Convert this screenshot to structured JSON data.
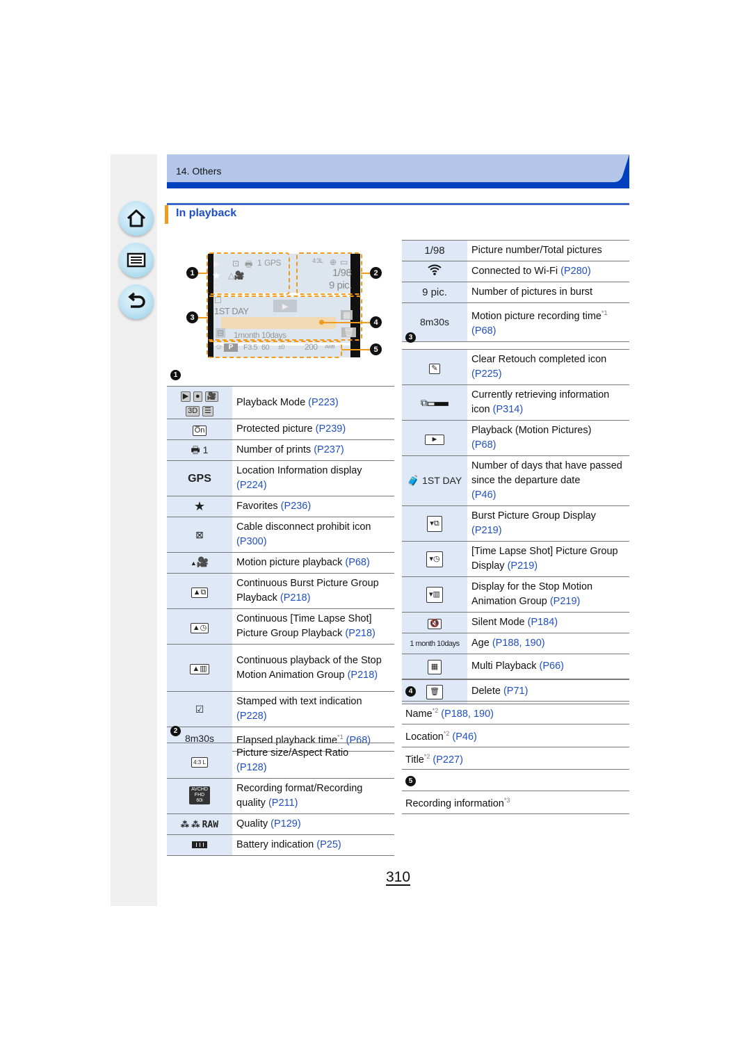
{
  "header": {
    "chapter": "14. Others",
    "section_title": "In playback"
  },
  "nav": [
    {
      "name": "home",
      "icon": "home-icon"
    },
    {
      "name": "contents",
      "icon": "list-icon"
    },
    {
      "name": "back",
      "icon": "back-arrow-icon"
    }
  ],
  "screen": {
    "callouts": [
      "1",
      "2",
      "3",
      "4",
      "5"
    ],
    "top_left": {
      "prints": "1",
      "gps": "GPS"
    },
    "top_right": {
      "pic_num": "1/98",
      "burst": "9 pic."
    },
    "middle": {
      "day": "1ST DAY",
      "age": "1month 10days"
    },
    "bottom": {
      "mode": "P",
      "aperture": "F3.5",
      "shutter": "60",
      "exposure": "±0",
      "iso": "200",
      "wb": "AWB"
    }
  },
  "group1": {
    "marker": "1",
    "rows": [
      {
        "icon": "playback-mode-icons",
        "text": "Playback Mode",
        "ref": "(P223)"
      },
      {
        "icon": "protect-icon",
        "icon_text": "Ōn",
        "text": "Protected picture",
        "ref": "(P239)"
      },
      {
        "icon": "print-icon",
        "icon_text": "1",
        "text": "Number of prints",
        "ref": "(P237)"
      },
      {
        "icon": "gps-icon",
        "icon_text": "GPS",
        "text": "Location Information display",
        "ref": "(P224)"
      },
      {
        "icon": "star-icon",
        "icon_text": "★",
        "text": "Favorites",
        "ref": "(P236)"
      },
      {
        "icon": "cable-disconnect-icon",
        "text": "Cable disconnect prohibit icon",
        "ref": "(P300)"
      },
      {
        "icon": "motion-picture-icon",
        "text": "Motion picture playback",
        "ref": "(P68)"
      },
      {
        "icon": "burst-group-play-icon",
        "text": "Continuous Burst Picture Group Playback",
        "ref": "(P218)"
      },
      {
        "icon": "time-lapse-play-icon",
        "text": "Continuous [Time Lapse Shot] Picture Group Playback",
        "ref": "(P218)"
      },
      {
        "icon": "stop-motion-play-icon",
        "text": "Continuous playback of the Stop Motion Animation Group",
        "ref": "(P218)"
      },
      {
        "icon": "text-stamp-icon",
        "text": "Stamped with text indication",
        "ref": "(P228)"
      },
      {
        "icon": "elapsed-time",
        "icon_text": "8m30s",
        "text": "Elapsed playback time",
        "sup": "*1",
        "ref": "(P68)"
      }
    ]
  },
  "group2": {
    "marker": "2",
    "rows": [
      {
        "icon": "picture-size-icon",
        "icon_text": "4:3 L",
        "text": "Picture size/Aspect Ratio",
        "ref": "(P128)"
      },
      {
        "icon": "recording-format-icon",
        "icon_text": "AVCHD FHD 60i",
        "text": "Recording format/Recording quality",
        "ref": "(P211)"
      },
      {
        "icon": "quality-icon",
        "icon_text": "RAW",
        "text": "Quality",
        "ref": "(P129)"
      },
      {
        "icon": "battery-icon",
        "text": "Battery indication",
        "ref": "(P25)"
      }
    ],
    "right_rows": [
      {
        "icon": "picture-number",
        "icon_text": "1/98",
        "text": "Picture number/Total pictures",
        "ref": ""
      },
      {
        "icon": "wifi-icon",
        "text": "Connected to Wi-Fi",
        "ref": "(P280)"
      },
      {
        "icon": "burst-count",
        "icon_text": "9 pic.",
        "text": "Number of pictures in burst",
        "ref": ""
      },
      {
        "icon": "recording-time",
        "icon_text": "8m30s",
        "text": "Motion picture recording time",
        "sup": "*1",
        "ref": "(P68)"
      }
    ]
  },
  "group3": {
    "marker": "3",
    "rows": [
      {
        "icon": "clear-retouch-icon",
        "text": "Clear Retouch completed icon",
        "ref": "(P225)"
      },
      {
        "icon": "retrieving-info-icon",
        "text": "Currently retrieving information icon",
        "ref": "(P314)"
      },
      {
        "icon": "play-icon",
        "icon_text": "►",
        "text": "Playback (Motion Pictures)",
        "ref": "(P68)"
      },
      {
        "icon": "travel-day-icon",
        "icon_text": "1ST DAY",
        "text": "Number of days that have passed since the departure date",
        "ref": "(P46)"
      },
      {
        "icon": "burst-group-display-icon",
        "text": "Burst Picture Group Display",
        "ref": "(P219)"
      },
      {
        "icon": "time-lapse-group-icon",
        "text": "[Time Lapse Shot] Picture Group Display",
        "ref": "(P219)"
      },
      {
        "icon": "stop-motion-group-icon",
        "text": "Display for the Stop Motion Animation Group",
        "ref": "(P219)"
      },
      {
        "icon": "silent-mode-icon",
        "text": "Silent Mode",
        "ref": "(P184)"
      },
      {
        "icon": "age",
        "icon_text": "1 month 10days",
        "text": "Age",
        "ref": "(P188, 190)"
      },
      {
        "icon": "multi-playback-icon",
        "text": "Multi Playback",
        "ref": "(P66)"
      },
      {
        "icon": "delete-icon",
        "text": "Delete",
        "ref": "(P71)"
      }
    ]
  },
  "group4": {
    "marker": "4",
    "rows": [
      {
        "text": "Name",
        "sup": "*2",
        "ref": "(P188, 190)"
      },
      {
        "text": "Location",
        "sup": "*2",
        "ref": "(P46)"
      },
      {
        "text": "Title",
        "sup": "*2",
        "ref": "(P227)"
      }
    ]
  },
  "group5": {
    "marker": "5",
    "rows": [
      {
        "text": "Recording information",
        "sup": "*3",
        "ref": ""
      }
    ]
  },
  "page_number": "310"
}
